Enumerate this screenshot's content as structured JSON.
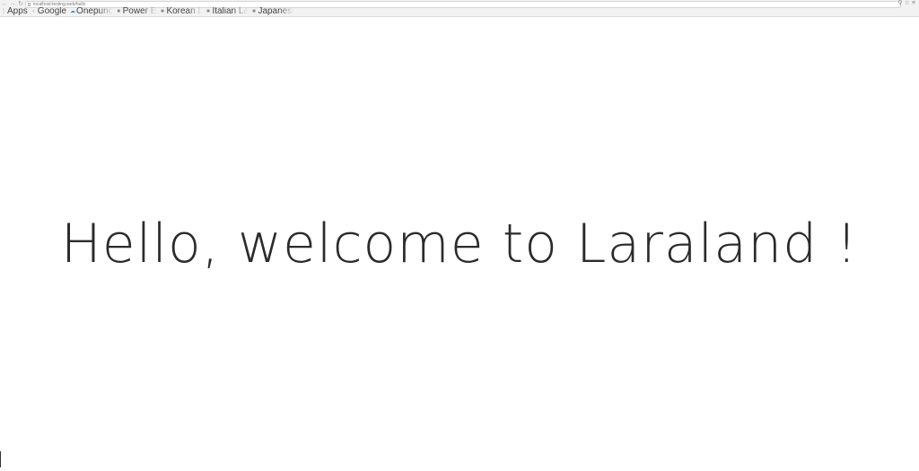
{
  "browser": {
    "nav": {
      "back_icon": "arrow-left-icon",
      "forward_icon": "arrow-right-icon",
      "reload_icon": "reload-icon"
    },
    "address": "localhost:testing.web/hello",
    "right_icons": [
      "zoom-icon",
      "star-icon",
      "menu-icon"
    ]
  },
  "bookmarks": [
    {
      "icon": "apps-grid-icon",
      "label": "Apps"
    },
    {
      "icon": "google-icon",
      "label": "Google"
    },
    {
      "icon": "cloud-icon",
      "label": "Onepunc"
    },
    {
      "icon": "folder-icon",
      "label": "Power B"
    },
    {
      "icon": "folder-icon",
      "label": "Korean L"
    },
    {
      "icon": "folder-icon",
      "label": "Italian La"
    },
    {
      "icon": "folder-icon",
      "label": "Japanese"
    }
  ],
  "page": {
    "title": "Hello, welcome to Laraland !"
  },
  "colors": {
    "chrome_bg": "#f2f2f2",
    "page_bg": "#ffffff",
    "title_text": "#2b2b2b"
  }
}
